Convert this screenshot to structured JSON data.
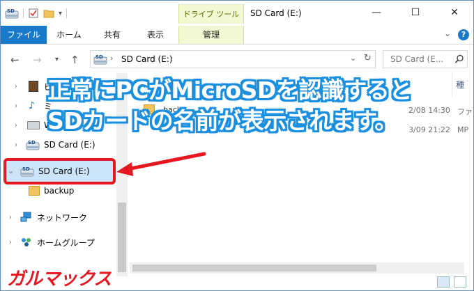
{
  "window": {
    "title": "SD Card (E:)",
    "context_group": "ドライブ ツール",
    "controls": {
      "minimize": "—",
      "maximize": "☐",
      "close": "✕"
    }
  },
  "ribbon": {
    "tabs": [
      {
        "label": "ファイル"
      },
      {
        "label": "ホーム"
      },
      {
        "label": "共有"
      },
      {
        "label": "表示"
      },
      {
        "label": "管理"
      }
    ],
    "help": "?"
  },
  "address": {
    "path": "SD Card (E:)",
    "search_placeholder": "SD Card (E..."
  },
  "nav_pane": {
    "items": [
      {
        "label": "ピ"
      },
      {
        "label": "ミ"
      },
      {
        "label": "W"
      },
      {
        "label": "SD Card (E:)"
      },
      {
        "label": "SD Card (E:)",
        "selected": true
      },
      {
        "label": "backup"
      },
      {
        "label": "ネットワーク"
      },
      {
        "label": "ホームグループ"
      }
    ]
  },
  "content": {
    "column_type": "種",
    "rows": [
      {
        "name": "back",
        "date": "2/08 14:30",
        "type": "ファ"
      },
      {
        "name": "",
        "date": "3/09 21:22",
        "type": "MP"
      }
    ]
  },
  "annotation": {
    "line1": "正常にPCがMicroSDを認識すると",
    "line2": "SDカードの名前が表示されます。"
  },
  "watermark": {
    "text": "ガルマックス"
  },
  "colors": {
    "accent": "#1979ca",
    "highlight": "#e5171f",
    "banner_outline": "#1a8fe0",
    "context_tab": "#f3f8d2"
  }
}
